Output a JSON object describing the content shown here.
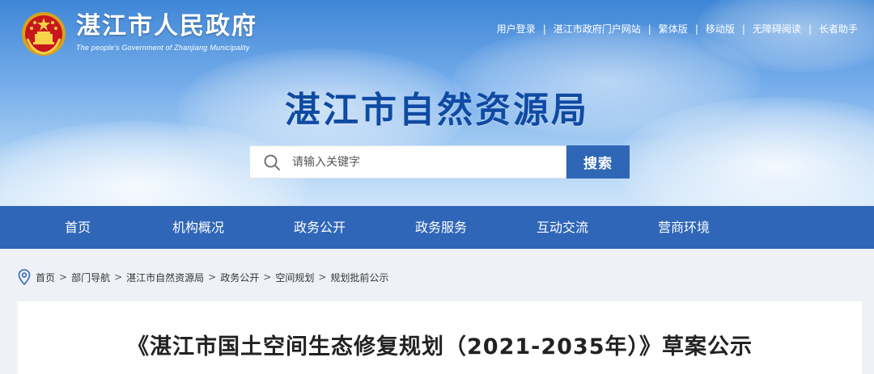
{
  "site": {
    "name_cn": "湛江市人民政府",
    "name_en": "The people's Government of Zhanjiang Municipality"
  },
  "top_links": [
    {
      "label": "用户登录"
    },
    {
      "label": "湛江市政府门户网站"
    },
    {
      "label": "繁体版"
    },
    {
      "label": "移动版"
    },
    {
      "label": "无障碍阅读"
    },
    {
      "label": "长者助手"
    }
  ],
  "bureau_title": "湛江市自然资源局",
  "search": {
    "placeholder": "请输入关键字",
    "button_label": "搜索"
  },
  "nav": [
    {
      "label": "首页"
    },
    {
      "label": "机构概况"
    },
    {
      "label": "政务公开"
    },
    {
      "label": "政务服务"
    },
    {
      "label": "互动交流"
    },
    {
      "label": "营商环境"
    }
  ],
  "breadcrumb": [
    {
      "label": "首页"
    },
    {
      "label": "部门导航"
    },
    {
      "label": "湛江市自然资源局"
    },
    {
      "label": "政务公开"
    },
    {
      "label": "空间规划"
    },
    {
      "label": "规划批前公示"
    }
  ],
  "article": {
    "title": "《湛江市国土空间生态修复规划（2021-2035年）》草案公示"
  },
  "colors": {
    "nav_bg": "#2f66b8",
    "search_button": "#2f67b6",
    "bureau_title": "#0f4aa3"
  }
}
